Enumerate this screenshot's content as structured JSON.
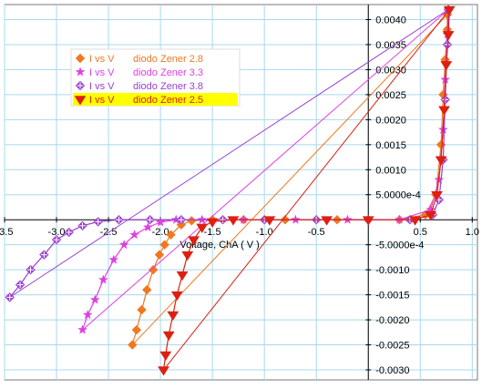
{
  "chart_data": {
    "type": "scatter",
    "title": "",
    "xlabel": "Voltage, ChA ( V )",
    "ylabel": "",
    "xlim": [
      -3.5,
      1.05
    ],
    "ylim": [
      -0.0032,
      0.0043
    ],
    "grid": true,
    "legend_position": "top-left",
    "x_ticks": [
      {
        "value": -3.5,
        "label": "-3.5"
      },
      {
        "value": -3.0,
        "label": "-3.0"
      },
      {
        "value": -2.5,
        "label": "-2.5"
      },
      {
        "value": -2.0,
        "label": "-2.0"
      },
      {
        "value": -1.5,
        "label": "-1.5"
      },
      {
        "value": -1.0,
        "label": "-1.0"
      },
      {
        "value": -0.5,
        "label": "-0.5"
      },
      {
        "value": 0.5,
        "label": "0.5"
      },
      {
        "value": 1.0,
        "label": "1.0"
      }
    ],
    "y_ticks": [
      {
        "value": 0.004,
        "label": "0.0040"
      },
      {
        "value": 0.0035,
        "label": "0.0035"
      },
      {
        "value": 0.003,
        "label": "0.0030"
      },
      {
        "value": 0.0025,
        "label": "0.0025"
      },
      {
        "value": 0.002,
        "label": "0.0020"
      },
      {
        "value": 0.0015,
        "label": "0.0015"
      },
      {
        "value": 0.001,
        "label": "0.0010"
      },
      {
        "value": 0.0005,
        "label": "5.0000e-4"
      },
      {
        "value": -0.0005,
        "label": "-5.0000e-4"
      },
      {
        "value": -0.001,
        "label": "-0.0010"
      },
      {
        "value": -0.0015,
        "label": "-0.0015"
      },
      {
        "value": -0.002,
        "label": "-0.0020"
      },
      {
        "value": -0.0025,
        "label": "-0.0025"
      },
      {
        "value": -0.003,
        "label": "-0.0030"
      }
    ],
    "series": [
      {
        "name": "diodo Zener 2.8",
        "legend_label": "I vs V",
        "color": "#f07820",
        "marker": "diamond",
        "x": [
          -2.27,
          -2.23,
          -2.18,
          -2.13,
          -2.07,
          -2.01,
          -1.96,
          -1.9,
          -1.8,
          -1.7,
          -1.5,
          -1.2,
          -0.8,
          -0.3,
          0.3,
          0.55,
          0.65,
          0.7,
          0.72,
          0.74,
          0.76,
          0.76
        ],
        "y": [
          -0.0025,
          -0.0022,
          -0.0018,
          -0.0014,
          -0.001,
          -0.0007,
          -0.0005,
          -0.0003,
          -0.0001,
          -2e-05,
          0.0,
          0.0,
          0.0,
          0.0,
          0.0,
          0.0001,
          0.0005,
          0.0015,
          0.0025,
          0.0032,
          0.0038,
          0.0041
        ]
      },
      {
        "name": "diodo Zener 3.3",
        "legend_label": "I vs V",
        "color": "#e040e0",
        "marker": "star",
        "x": [
          -2.75,
          -2.7,
          -2.63,
          -2.55,
          -2.45,
          -2.35,
          -2.25,
          -2.12,
          -2.0,
          -1.85,
          -1.6,
          -1.2,
          -0.7,
          -0.2,
          0.3,
          0.6,
          0.68,
          0.72,
          0.74,
          0.76,
          0.77
        ],
        "y": [
          -0.0022,
          -0.0019,
          -0.0016,
          -0.0012,
          -0.0008,
          -0.0005,
          -0.0003,
          -0.00015,
          -5e-05,
          0.0,
          0.0,
          0.0,
          0.0,
          0.0,
          0.0,
          0.0002,
          0.0008,
          0.0018,
          0.0028,
          0.0037,
          0.0042
        ]
      },
      {
        "name": "diodo Zener 3.8",
        "legend_label": "I vs V",
        "color": "#9a40d0",
        "marker": "plus-diamond",
        "x": [
          -3.45,
          -3.35,
          -3.25,
          -3.12,
          -3.0,
          -2.88,
          -2.75,
          -2.6,
          -2.4,
          -2.1,
          -1.8,
          -1.4,
          -1.0,
          -0.5,
          0.0,
          0.4,
          0.62,
          0.68,
          0.72,
          0.74,
          0.76,
          0.77
        ],
        "y": [
          -0.00155,
          -0.0013,
          -0.001,
          -0.0007,
          -0.0004,
          -0.00025,
          -0.00012,
          -4e-05,
          0.0,
          0.0,
          0.0,
          0.0,
          0.0,
          0.0,
          0.0,
          0.0,
          0.0001,
          0.0004,
          0.0012,
          0.0024,
          0.0035,
          0.0042
        ]
      },
      {
        "name": "diodo Zener 2.5",
        "legend_label": "I vs V",
        "color": "#dd2010",
        "marker": "triangle-down",
        "x": [
          -1.97,
          -1.95,
          -1.92,
          -1.88,
          -1.84,
          -1.79,
          -1.74,
          -1.68,
          -1.6,
          -1.5,
          -1.3,
          -0.95,
          -0.4,
          0.0,
          0.45,
          0.6,
          0.66,
          0.7,
          0.73,
          0.75,
          0.77,
          0.78
        ],
        "y": [
          -0.003,
          -0.0027,
          -0.0023,
          -0.0019,
          -0.0015,
          -0.0011,
          -0.0007,
          -0.0004,
          -0.00015,
          -4e-05,
          0.0,
          0.0,
          0.0,
          0.0,
          0.0,
          0.0001,
          0.0005,
          0.0012,
          0.0022,
          0.0031,
          0.0037,
          0.0042
        ]
      }
    ]
  }
}
